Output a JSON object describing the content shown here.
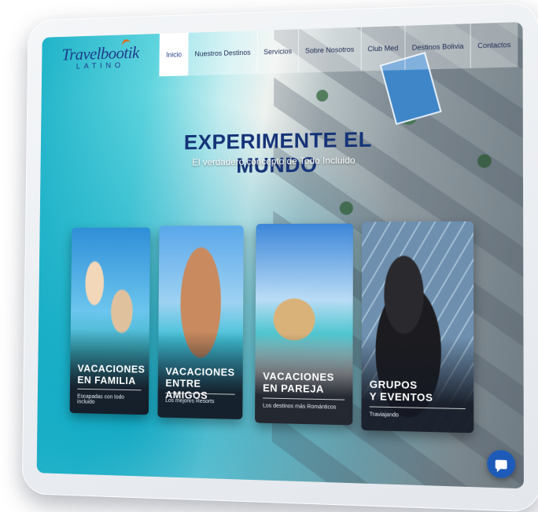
{
  "nav": {
    "logo_main": "Travelbootik",
    "logo_sub": "LATINO",
    "items": [
      {
        "label": "Inicio",
        "active": true
      },
      {
        "label": "Nuestros Destinos",
        "active": false
      },
      {
        "label": "Servicios",
        "active": false
      },
      {
        "label": "Sobre Nosotros",
        "active": false
      },
      {
        "label": "Club Med",
        "active": false
      },
      {
        "label": "Destinos Bolivia",
        "active": false
      },
      {
        "label": "Contactos",
        "active": false
      }
    ]
  },
  "hero": {
    "title": "EXPERIMENTE EL MUNDO",
    "subtitle": "El verdadero concepto de Todo Incluido"
  },
  "cards": [
    {
      "title": "VACACIONES\nEN FAMILIA",
      "subtitle": "Escapadas con todo incluido"
    },
    {
      "title": "VACACIONES\nENTRE AMIGOS",
      "subtitle": "Los mejores Resorts"
    },
    {
      "title": "VACACIONES\nEN PAREJA",
      "subtitle": "Los destinos más Románticos"
    },
    {
      "title": "GRUPOS\nY EVENTOS",
      "subtitle": "Traviajando"
    }
  ],
  "chat": {
    "icon": "chat-icon"
  },
  "colors": {
    "brand": "#1d3a8a",
    "accent": "#e06a1b",
    "chat": "#1e5bb8"
  }
}
